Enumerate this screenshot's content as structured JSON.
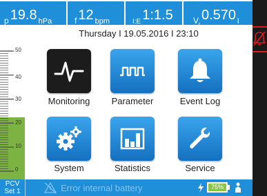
{
  "topbar": {
    "pressure": {
      "symbol": "p",
      "value": "19.8",
      "unit": "hPa"
    },
    "frequency": {
      "symbol": "f",
      "value": "12",
      "unit": "bpm"
    },
    "ie_ratio": {
      "symbol": "I:E",
      "value": "1:1.5"
    },
    "tidal_volume": {
      "symbol": "V",
      "subscript": "t",
      "value": "0.570",
      "unit": "l"
    }
  },
  "datetime": "Thursday I 19.05.2016 I 23:10",
  "gauge": {
    "labels": [
      "50",
      "40",
      "30",
      "20",
      "10",
      "0"
    ],
    "fill_level": 0.4,
    "fill_color": "#7cb342"
  },
  "tiles": [
    {
      "label": "Monitoring",
      "icon": "waveform-icon",
      "active": true
    },
    {
      "label": "Parameter",
      "icon": "pulse-wave-icon",
      "active": false
    },
    {
      "label": "Event Log",
      "icon": "bell-icon",
      "active": false
    },
    {
      "label": "System",
      "icon": "gears-icon",
      "active": false
    },
    {
      "label": "Statistics",
      "icon": "bar-chart-icon",
      "active": false
    },
    {
      "label": "Service",
      "icon": "wrench-icon",
      "active": false
    }
  ],
  "bottombar": {
    "mode_line1": "PCV",
    "mode_line2": "Set 1",
    "warning_text": "Error internal battery",
    "battery_percent": "75%"
  },
  "colors": {
    "accent_blue": "#1f8fd9",
    "alarm_red": "#e01b1b",
    "battery_green": "#8bc34a"
  }
}
